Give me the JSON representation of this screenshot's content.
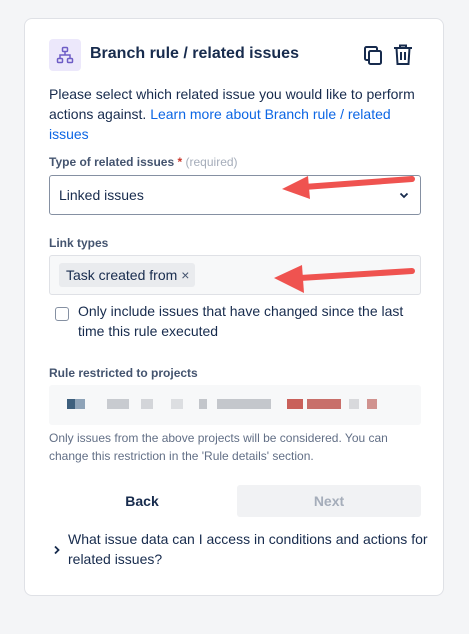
{
  "panel": {
    "title": "Branch rule / related issues",
    "icons": {
      "branch": "branch-icon",
      "copy": "copy-icon",
      "delete": "trash-icon"
    }
  },
  "description": {
    "text": "Please select which related issue you would like to perform actions against.",
    "link": "Learn more about Branch rule / related issues"
  },
  "related_type": {
    "label": "Type of related issues",
    "required_marker": "*",
    "required_note": "(required)",
    "value": "Linked issues"
  },
  "link_types": {
    "label": "Link types",
    "tags": [
      "Task created from"
    ],
    "remove_glyph": "×"
  },
  "changed_only": {
    "checked": false,
    "label": "Only include issues that have changed since the last time this rule executed"
  },
  "projects": {
    "label": "Rule restricted to projects",
    "helper": "Only issues from the above projects will be considered. You can change this restriction in the 'Rule details' section."
  },
  "actions": {
    "back": "Back",
    "next": "Next"
  },
  "faq": {
    "text": "What issue data can I access in conditions and actions for related issues?"
  },
  "colors": {
    "link": "#0c66e4",
    "annotation_arrow": "#ef5350",
    "icon_bg": "#ece8fb",
    "icon_fg": "#6e5dc6"
  }
}
